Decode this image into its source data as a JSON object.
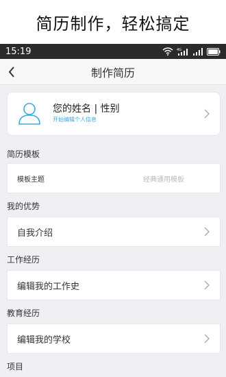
{
  "banner": {
    "text": "简历制作，轻松搞定"
  },
  "status_bar": {
    "time": "15:19",
    "icons": [
      "wifi-icon",
      "signal-4g-icon",
      "signal-icon",
      "battery-icon"
    ]
  },
  "nav": {
    "back_icon": "back-arrow-icon",
    "title": "制作简历"
  },
  "profile": {
    "avatar_icon": "user-avatar-icon",
    "name": "您的姓名 | 性别",
    "hint": "开始编辑个人信息"
  },
  "sections": [
    {
      "label": "简历模板",
      "row_label": "模板主题",
      "row_value": "经典通用模板"
    },
    {
      "label": "我的优势",
      "row_label": "自我介绍"
    },
    {
      "label": "工作经历",
      "row_label": "编辑我的工作史"
    },
    {
      "label": "教育经历",
      "row_label": "编辑我的学校"
    },
    {
      "label": "项目"
    }
  ],
  "colors": {
    "accent": "#3ba9df",
    "status_bar": "#2b2b2b",
    "content_bg": "#f0f0f4"
  }
}
